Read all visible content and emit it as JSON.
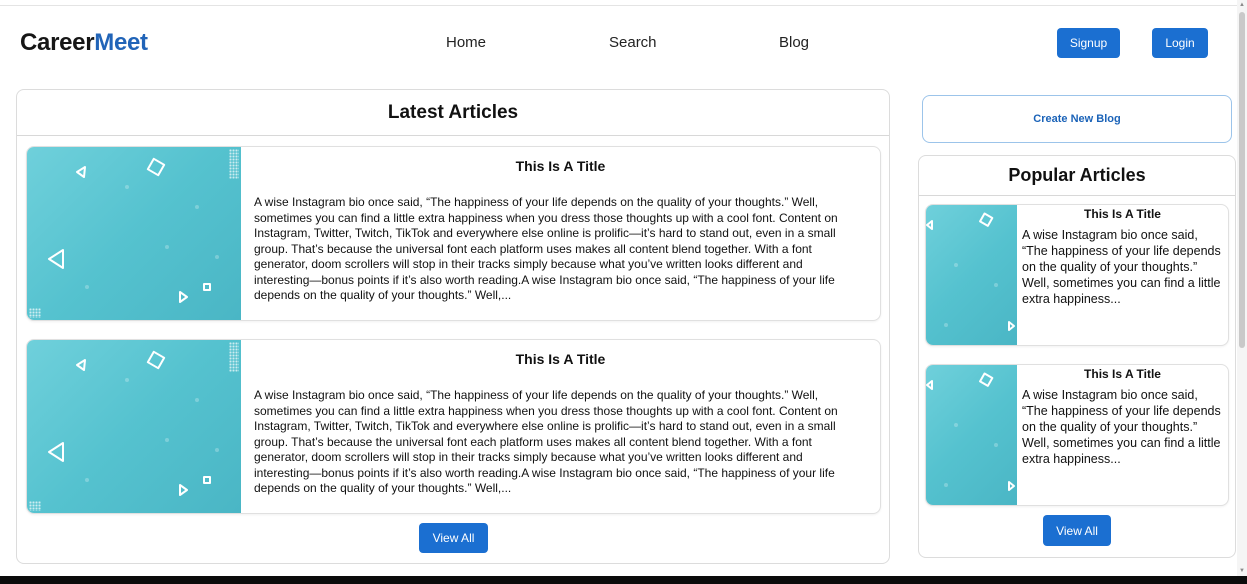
{
  "header": {
    "logo_part1": "Career",
    "logo_part2": "Meet",
    "nav": [
      "Home",
      "Search",
      "Blog"
    ],
    "signup_label": "Signup",
    "login_label": "Login"
  },
  "latest": {
    "heading": "Latest Articles",
    "articles": [
      {
        "title": "This Is A Title",
        "body": "A wise Instagram bio once said, “The happiness of your life depends on the quality of your thoughts.” Well, sometimes you can find a little extra happiness when you dress those thoughts up with a cool font. Content on Instagram, Twitter, Twitch, TikTok and everywhere else online is prolific—it’s hard to stand out, even in a small group. That’s because the universal font each platform uses makes all content blend together. With a font generator, doom scrollers will stop in their tracks simply because what you’ve written looks different and interesting—bonus points if it’s also worth reading.A wise Instagram bio once said, “The happiness of your life depends on the quality of your thoughts.” Well,..."
      },
      {
        "title": "This Is A Title",
        "body": "A wise Instagram bio once said, “The happiness of your life depends on the quality of your thoughts.” Well, sometimes you can find a little extra happiness when you dress those thoughts up with a cool font. Content on Instagram, Twitter, Twitch, TikTok and everywhere else online is prolific—it’s hard to stand out, even in a small group. That’s because the universal font each platform uses makes all content blend together. With a font generator, doom scrollers will stop in their tracks simply because what you’ve written looks different and interesting—bonus points if it’s also worth reading.A wise Instagram bio once said, “The happiness of your life depends on the quality of your thoughts.” Well,..."
      }
    ],
    "view_all_label": "View All"
  },
  "sidebar": {
    "create_label": "Create New Blog",
    "popular_heading": "Popular Articles",
    "articles": [
      {
        "title": "This Is A Title",
        "body": "A wise Instagram bio once said, “The happiness of your life depends on the quality of your thoughts.” Well, sometimes you can find a little extra happiness..."
      },
      {
        "title": "This Is A Title",
        "body": "A wise Instagram bio once said, “The happiness of your life depends on the quality of your thoughts.” Well, sometimes you can find a little extra happiness..."
      }
    ],
    "view_all_label": "View All"
  },
  "colors": {
    "brand_blue": "#2164b8",
    "button_blue": "#1b6fd1",
    "thumbnail_teal": "#55c2cf"
  }
}
